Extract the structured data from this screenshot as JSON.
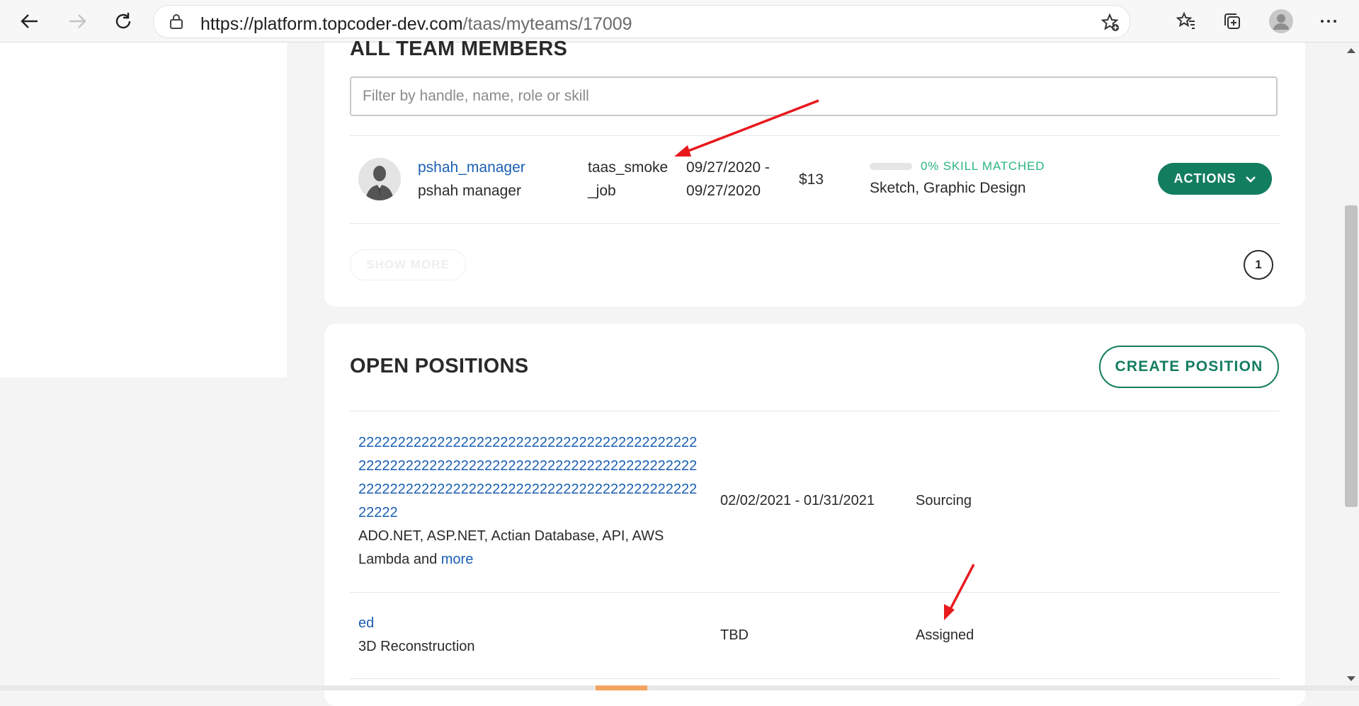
{
  "browser": {
    "url_host": "https://platform.topcoder-dev.com",
    "url_path": "/taas/myteams/17009"
  },
  "team_members": {
    "title": "ALL TEAM MEMBERS",
    "filter_placeholder": "Filter by handle, name, role or skill",
    "members": [
      {
        "handle": "pshah_manager",
        "name": "pshah manager",
        "job_line1": "taas_smoke",
        "job_line2": "_job",
        "date_start": "09/27/2020 -",
        "date_end": "09/27/2020",
        "rate": "$13",
        "skill_matched": "0% SKILL MATCHED",
        "skill_match_fraction": 0,
        "skills": "Sketch, Graphic Design",
        "actions_label": "ACTIONS"
      }
    ],
    "show_more_label": "SHOW MORE",
    "page_number": "1"
  },
  "open_positions": {
    "title": "OPEN POSITIONS",
    "create_label": "CREATE POSITION",
    "positions": [
      {
        "title_line1": "2222222222222222222222222222222222222222222",
        "title_line2": "2222222222222222222222222222222222222222222",
        "title_line3": "2222222222222222222222222222222222222222222",
        "title_line4": "22222",
        "skills_line1": "ADO.NET, ASP.NET, Actian Database, API, AWS",
        "skills_line2": "Lambda and ",
        "more_label": "more",
        "dates": "02/02/2021 - 01/31/2021",
        "status": "Sourcing"
      },
      {
        "title": "ed",
        "skills": "3D Reconstruction",
        "dates": "TBD",
        "status": "Assigned"
      }
    ]
  },
  "colors": {
    "accent_green": "#137d60",
    "skill_green": "#2ab57d",
    "link_blue": "#1a5fb4",
    "annotation_red": "#e8191d"
  }
}
